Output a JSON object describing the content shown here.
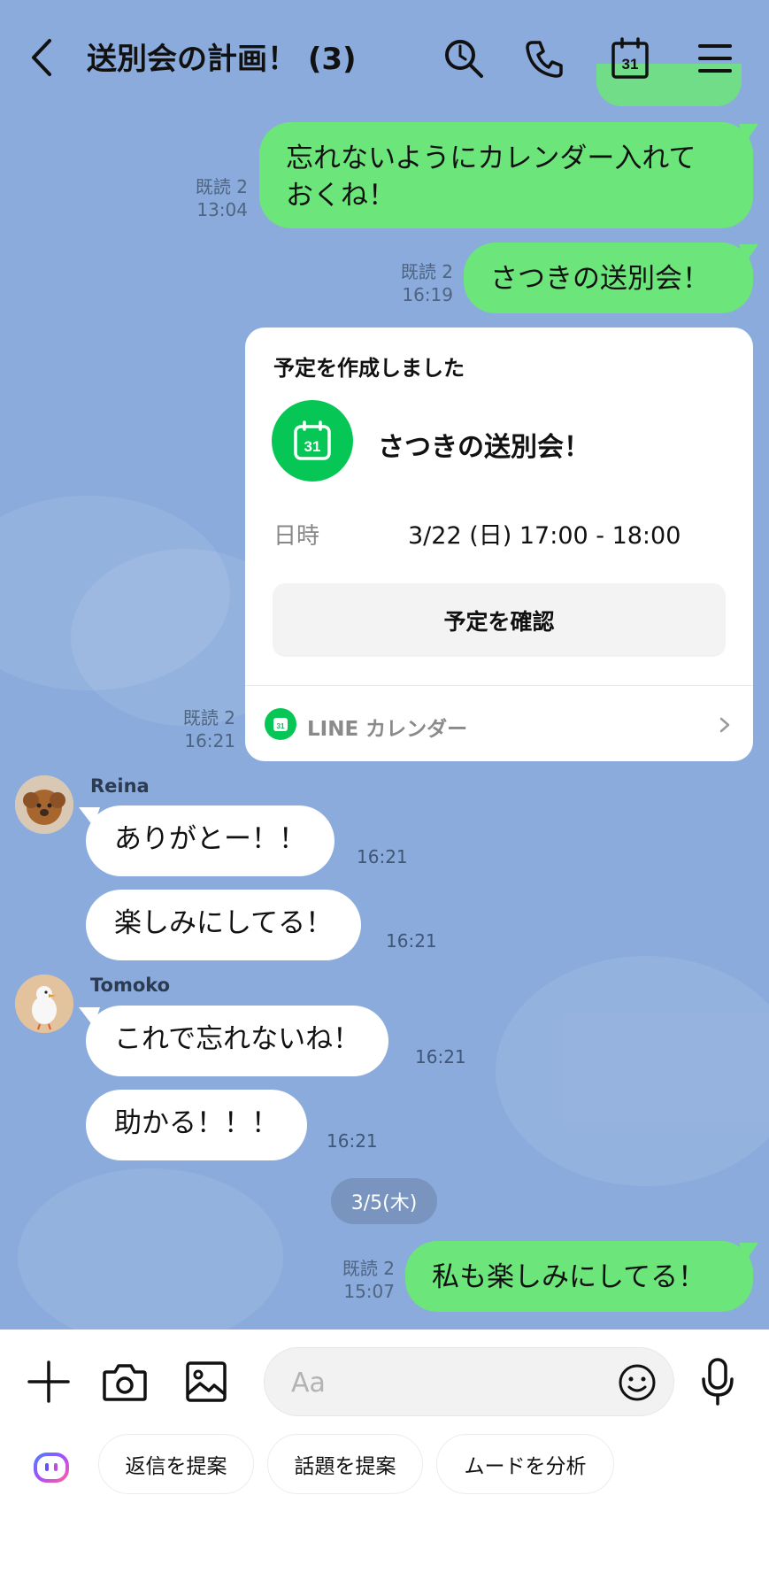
{
  "header": {
    "title": "送別会の計画！ (3)",
    "back_icon": "chevron-left-icon",
    "search_icon": "search-icon",
    "call_icon": "phone-icon",
    "calendar_icon": "calendar-icon",
    "calendar_icon_day": "31",
    "menu_icon": "hamburger-menu-icon"
  },
  "messages": {
    "m1": {
      "text_line1": "忘れないようにカレンダー入れて",
      "text_line2": "おくね！",
      "read": "既読 2",
      "time": "13:04"
    },
    "m2": {
      "text": "さつきの送別会！",
      "read": "既読 2",
      "time": "16:19"
    },
    "card": {
      "heading": "予定を作成しました",
      "event_title": "さつきの送別会！",
      "datetime_label": "日時",
      "datetime_value": "3/22 (日) 17:00 - 18:00",
      "confirm_button": "予定を確認",
      "footer_label": "LINE カレンダー",
      "icon_day": "31",
      "read": "既読 2",
      "time": "16:21"
    },
    "reina": {
      "name": "Reina",
      "bubble1": "ありがとー！！",
      "time1": "16:21",
      "bubble2": "楽しみにしてる！",
      "time2": "16:21"
    },
    "tomoko": {
      "name": "Tomoko",
      "bubble1": "これで忘れないね！",
      "time1": "16:21",
      "bubble2": "助かる！！！",
      "time2": "16:21"
    },
    "date_separator": "3/5(木)",
    "m_last": {
      "text": "私も楽しみにしてる！",
      "read": "既読 2",
      "time": "15:07"
    }
  },
  "composer": {
    "placeholder": "Aa",
    "plus_icon": "plus-icon",
    "camera_icon": "camera-icon",
    "image_icon": "image-icon",
    "emoji_icon": "emoji-icon",
    "mic_icon": "microphone-icon"
  },
  "ai_suggestions": {
    "ai_icon": "ai-assistant-icon",
    "chips": [
      "返信を提案",
      "話題を提案",
      "ムードを分析"
    ]
  },
  "colors": {
    "chat_background": "#8aabdb",
    "sent_bubble": "#6ce57a",
    "received_bubble": "#ffffff",
    "line_green": "#06c755"
  }
}
